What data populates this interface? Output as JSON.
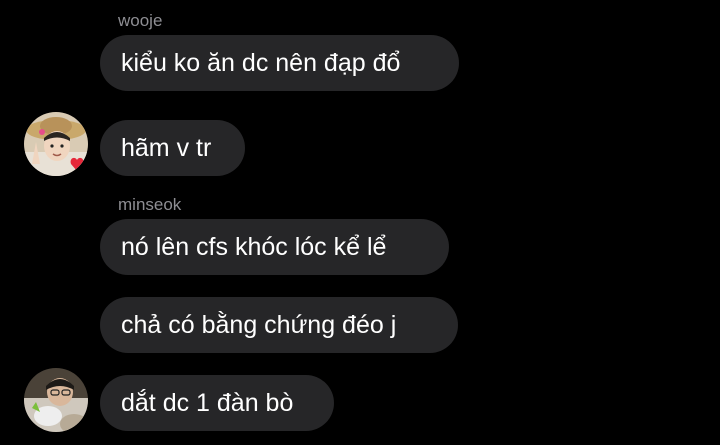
{
  "thread": {
    "groups": [
      {
        "sender": "wooje",
        "avatar": "avatar-wooje-icon",
        "messages": [
          "kiểu ko ăn dc nên đạp đổ",
          "hãm v tr"
        ]
      },
      {
        "sender": "minseok",
        "avatar": "avatar-minseok-icon",
        "messages": [
          "nó lên cfs khóc lóc kể lể",
          "chả có bằng chứng đéo j",
          "dắt dc 1 đàn bò"
        ]
      }
    ]
  },
  "colors": {
    "background": "#000000",
    "bubble": "#262628",
    "message_text": "#ffffff",
    "sender_text": "#8e8e93"
  }
}
